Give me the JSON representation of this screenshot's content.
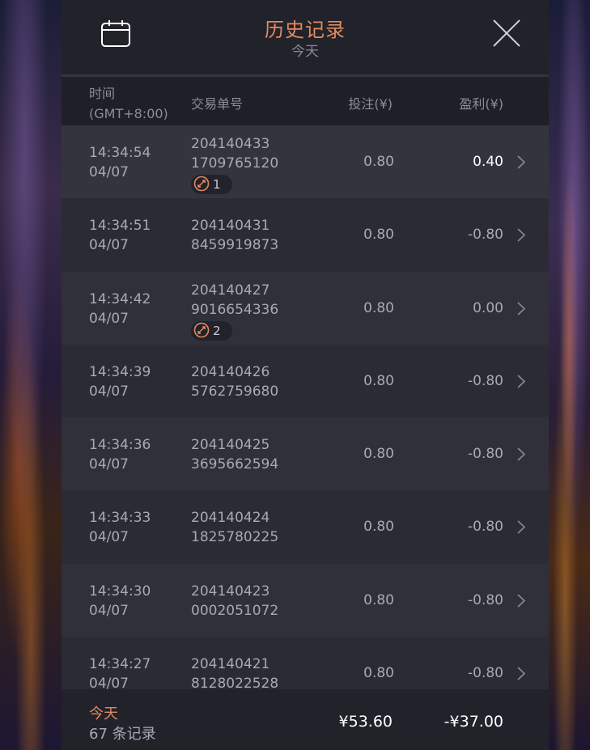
{
  "header": {
    "title": "历史记录",
    "subtitle": "今天",
    "calendar_icon": "calendar-icon",
    "close_icon": "close-icon"
  },
  "columns": {
    "time_line1": "时间",
    "time_line2": "(GMT+8:00)",
    "order_id": "交易单号",
    "bet": "投注(¥)",
    "profit": "盈利(¥)"
  },
  "rows": [
    {
      "time": "14:34:54",
      "date": "04/07",
      "id1": "204140433",
      "id2": "1709765120",
      "badge": "1",
      "bet": "0.80",
      "profit": "0.40"
    },
    {
      "time": "14:34:51",
      "date": "04/07",
      "id1": "204140431",
      "id2": "8459919873",
      "badge": "",
      "bet": "0.80",
      "profit": "-0.80"
    },
    {
      "time": "14:34:42",
      "date": "04/07",
      "id1": "204140427",
      "id2": "9016654336",
      "badge": "2",
      "bet": "0.80",
      "profit": "0.00"
    },
    {
      "time": "14:34:39",
      "date": "04/07",
      "id1": "204140426",
      "id2": "5762759680",
      "badge": "",
      "bet": "0.80",
      "profit": "-0.80"
    },
    {
      "time": "14:34:36",
      "date": "04/07",
      "id1": "204140425",
      "id2": "3695662594",
      "badge": "",
      "bet": "0.80",
      "profit": "-0.80"
    },
    {
      "time": "14:34:33",
      "date": "04/07",
      "id1": "204140424",
      "id2": "1825780225",
      "badge": "",
      "bet": "0.80",
      "profit": "-0.80"
    },
    {
      "time": "14:34:30",
      "date": "04/07",
      "id1": "204140423",
      "id2": "0002051072",
      "badge": "",
      "bet": "0.80",
      "profit": "-0.80"
    },
    {
      "time": "14:34:27",
      "date": "04/07",
      "id1": "204140421",
      "id2": "8128022528",
      "badge": "",
      "bet": "0.80",
      "profit": "-0.80"
    }
  ],
  "footer": {
    "label": "今天",
    "count": "67 条记录",
    "total_bet": "¥53.60",
    "total_profit": "-¥37.00"
  },
  "colors": {
    "accent": "#e08a5f",
    "panel": "#2b2b35",
    "header": "#22222b"
  }
}
